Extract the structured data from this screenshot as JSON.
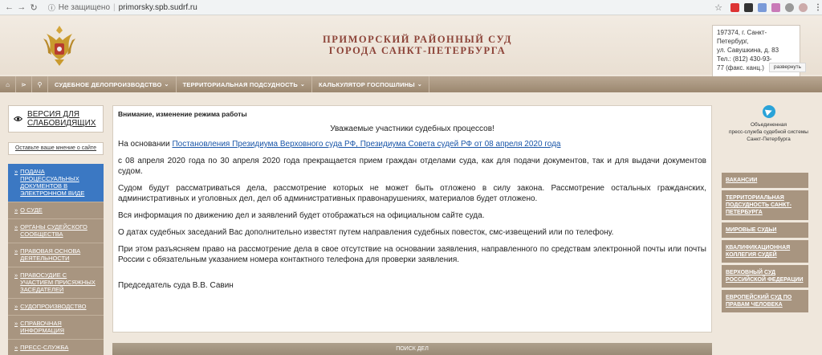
{
  "browser": {
    "security": "Не защищено",
    "url": "primorsky.spb.sudrf.ru"
  },
  "header": {
    "title_line1": "ПРИМОРСКИЙ РАЙОННЫЙ СУД",
    "title_line2": "ГОРОДА САНКТ-ПЕТЕРБУРГА",
    "address_lines": [
      "197374, г. Санкт-Петербург,",
      "ул. Савушкина, д. 83",
      "Тел.: (812) 430-93-",
      "77 (факс. канц.)"
    ],
    "expand_label": "развернуть"
  },
  "topnav": {
    "items": [
      {
        "label": "Судебное делопроизводство"
      },
      {
        "label": "Территориальная подсудность"
      },
      {
        "label": "Калькулятор госпошлины"
      }
    ]
  },
  "left": {
    "vision_label": "ВЕРСИЯ ДЛЯ СЛАБОВИДЯЩИХ",
    "feedback_label": "Оставьте ваше мнение о сайте",
    "menu": [
      "Подача процессуальных документов в электронном виде",
      "О суде",
      "Органы судейского сообщества",
      "Правовая основа деятельности",
      "Правосудие с участием присяжных заседателей",
      "Судопроизводство",
      "Справочная информация",
      "Пресс-служба"
    ]
  },
  "content": {
    "heading": "Внимание, изменение режима работы",
    "greeting": "Уважаемые участники судебных процессов!",
    "intro_prefix": "На основании ",
    "intro_link": "Постановления Президиума Верховного суда РФ, Президиума Совета судей РФ от 08 апреля 2020 года",
    "p1": "с 08 апреля 2020 года по 30 апреля 2020 года прекращается прием граждан отделами суда, как для подачи документов, так и для выдачи документов судом.",
    "p2": "Судом будут рассматриваться дела, рассмотрение которых не может быть отложено в силу закона. Рассмотрение остальных гражданских, административных и уголовных дел, дел об административных правонарушениях, материалов будет отложено.",
    "p3": "Вся информация по движению дел и заявлений будет отображаться на официальном сайте суда.",
    "p4": "О датах судебных заседаний Вас дополнительно известят путем направления судебных повесток, смс-извещений или по телефону.",
    "p5": "При этом разъясняем право на рассмотрение дела в свое отсутствие на основании заявления, направленного по средствам электронной почты или почты России с обязательным указанием номера контактного телефона для проверки заявления.",
    "signature": "Председатель суда В.В. Савин",
    "search_label": "ПОИСК ДЕЛ"
  },
  "right": {
    "press_lines": [
      "Объединенная",
      "пресс-служба судебной системы",
      "Санкт-Петербурга"
    ],
    "menu": [
      "Вакансии",
      "Территориальная подсудность Санкт-Петербурга",
      "Мировые судьи",
      "Квалификационная коллегия судей",
      "Верховный суд Российской Федерации",
      "Европейский суд по правам человека"
    ]
  },
  "colors": {
    "title": "#8d4439",
    "nav": "#a89580",
    "active": "#3b78c3",
    "link": "#1a56a8"
  }
}
